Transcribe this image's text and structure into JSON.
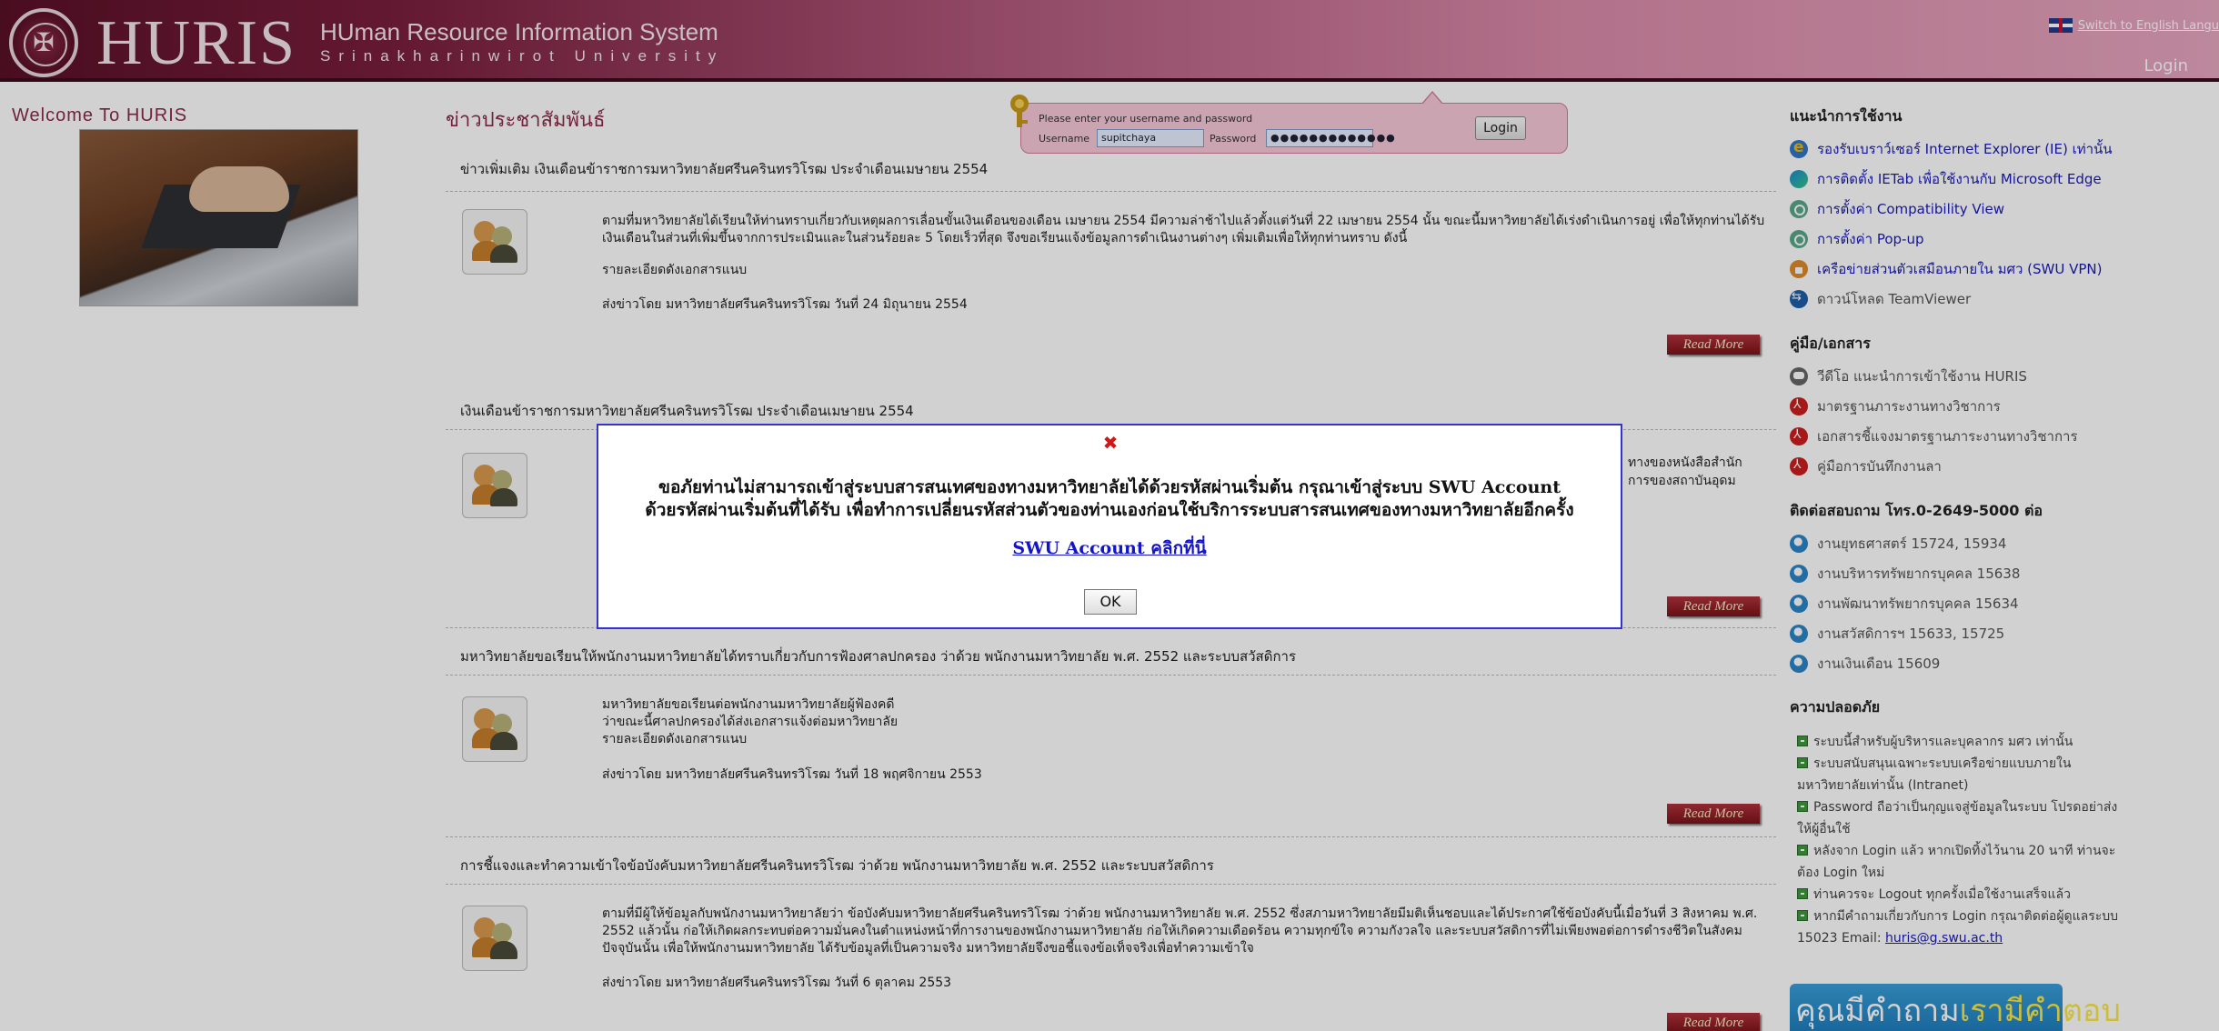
{
  "header": {
    "logo": "HURIS",
    "system_title": "HUman Resource Information System",
    "university": "Srinakharinwirot University",
    "lang_link": "Switch to English Langu",
    "login_link": "Login"
  },
  "left": {
    "welcome": "Welcome To HURIS"
  },
  "news": {
    "heading": "ข่าวประชาสัมพันธ์",
    "read_more": "Read More",
    "items": [
      {
        "title": "ข่าวเพิ่มเติม เงินเดือนข้าราชการมหาวิทยาลัยศรีนครินทรวิโรฒ ประจำเดือนเมษายน 2554",
        "body": [
          "ตามที่มหาวิทยาลัยได้เรียนให้ท่านทราบเกี่ยวกับเหตุผลการเลื่อนขั้นเงินเดือนของเดือน เมษายน 2554 มีความล่าช้าไปแล้วตั้งแต่วันที่ 22 เมษายน 2554 นั้น ขณะนี้มหาวิทยาลัยได้เร่งดำเนินการอยู่ เพื่อให้ทุกท่านได้รับเงินเดือนในส่วนที่เพิ่มขึ้นจากการประเมินและในส่วนร้อยละ 5 โดยเร็วที่สุด จึงขอเรียนแจ้งข้อมูลการดำเนินงานต่างๆ เพิ่มเติมเพื่อให้ทุกท่านทราบ ดังนี้",
          "รายละเอียดดังเอกสารแนบ",
          "ส่งข่าวโดย มหาวิทยาลัยศรีนครินทรวิโรฒ วันที่ 24 มิถุนายน 2554"
        ]
      },
      {
        "title": "เงินเดือนข้าราชการมหาวิทยาลัยศรีนครินทรวิโรฒ ประจำเดือนเมษายน 2554",
        "body_right": "ทางของหนังสือสำนัก",
        "body_right2": "การของสถาบันอุดม"
      },
      {
        "title": "มหาวิทยาลัยขอเรียนให้พนักงานมหาวิทยาลัยได้ทราบเกี่ยวกับการฟ้องศาลปกครอง ว่าด้วย พนักงานมหาวิทยาลัย พ.ศ. 2552 และระบบสวัสดิการ",
        "body": [
          "มหาวิทยาลัยขอเรียนต่อพนักงานมหาวิทยาลัยผู้ฟ้องคดี",
          "ว่าขณะนี้ศาลปกครองได้ส่งเอกสารแจ้งต่อมหาวิทยาลัย",
          "รายละเอียดดังเอกสารแนบ",
          "ส่งข่าวโดย มหาวิทยาลัยศรีนครินทรวิโรฒ วันที่ 18 พฤศจิกายน 2553"
        ]
      },
      {
        "title": "การชี้แจงและทำความเข้าใจข้อบังคับมหาวิทยาลัยศรีนครินทรวิโรฒ ว่าด้วย พนักงานมหาวิทยาลัย พ.ศ. 2552 และระบบสวัสดิการ",
        "body": [
          "ตามที่มีผู้ให้ข้อมูลกับพนักงานมหาวิทยาลัยว่า ข้อบังคับมหาวิทยาลัยศรีนครินทรวิโรฒ ว่าด้วย พนักงานมหาวิทยาลัย พ.ศ. 2552 ซึ่งสภามหาวิทยาลัยมีมติเห็นชอบและได้ประกาศใช้ข้อบังคับนี้เมื่อวันที่ 3 สิงหาคม พ.ศ. 2552 แล้วนั้น ก่อให้เกิดผลกระทบต่อความมั่นคงในตำแหน่งหน้าที่การงานของพนักงานมหาวิทยาลัย ก่อให้เกิดความเดือดร้อน ความทุกข์ใจ ความกังวลใจ และระบบสวัสดิการที่ไม่เพียงพอต่อการดำรงชีวิตในสังคมปัจจุบันนั้น เพื่อให้พนักงานมหาวิทยาลัย ได้รับข้อมูลที่เป็นความจริง มหาวิทยาลัยจึงขอชี้แจงข้อเท็จจริงเพื่อทำความเข้าใจ",
          "ส่งข่าวโดย มหาวิทยาลัยศรีนครินทรวิโรฒ วันที่ 6 ตุลาคม 2553"
        ]
      }
    ]
  },
  "login_box": {
    "message": "Please enter your username and password",
    "username_label": "Username",
    "username_value": "supitchaya",
    "password_label": "Password",
    "password_value": "●●●●●●●●●●●●●",
    "button": "Login"
  },
  "sidebar": {
    "recommend_heading": "แนะนำการใช้งาน",
    "recommend_items": [
      {
        "label": "รองรับเบราว์เซอร์ Internet Explorer (IE) เท่านั้น",
        "icon": "ie-icon"
      },
      {
        "label": "การติดตั้ง IETab เพื่อใช้งานกับ Microsoft Edge",
        "icon": "edge-icon"
      },
      {
        "label": "การตั้งค่า Compatibility View",
        "icon": "gear-icon"
      },
      {
        "label": "การตั้งค่า Pop-up",
        "icon": "gear-icon"
      },
      {
        "label": "เครือข่ายส่วนตัวเสมือนภายใน มศว (SWU VPN)",
        "icon": "lock-icon"
      },
      {
        "label": "ดาวน์โหลด TeamViewer",
        "icon": "teamviewer-icon"
      }
    ],
    "manual_heading": "คู่มือ/เอกสาร",
    "manual_items": [
      {
        "label": "วีดีโอ แนะนำการเข้าใช้งาน HURIS",
        "icon": "video-icon"
      },
      {
        "label": "มาตรฐานภาระงานทางวิชาการ",
        "icon": "pdf-icon"
      },
      {
        "label": "เอกสารชี้แจงมาตรฐานภาระงานทางวิชาการ",
        "icon": "pdf-icon"
      },
      {
        "label": "คู่มือการบันทึกงานลา",
        "icon": "pdf-icon"
      }
    ],
    "contact_heading": "ติดต่อสอบถาม โทร.0-2649-5000 ต่อ",
    "contact_items": [
      {
        "label": "งานยุทธศาสตร์ 15724, 15934",
        "icon": "person-icon"
      },
      {
        "label": "งานบริหารทรัพยากรบุคคล 15638",
        "icon": "person-icon"
      },
      {
        "label": "งานพัฒนาทรัพยากรบุคคล 15634",
        "icon": "person-icon"
      },
      {
        "label": "งานสวัสดิการฯ 15633, 15725",
        "icon": "person-icon"
      },
      {
        "label": "งานเงินเดือน 15609",
        "icon": "person-icon"
      }
    ],
    "security_heading": "ความปลอดภัย",
    "security_items": [
      "ระบบนี้สำหรับผู้บริหารและบุคลากร มศว เท่านั้น",
      "ระบบสนับสนุนเฉพาะระบบเครือข่ายแบบภายใน",
      "มหาวิทยาลัยเท่านั้น (Intranet)",
      "Password ถือว่าเป็นกุญแจสู่ข้อมูลในระบบ โปรดอย่าส่ง",
      "ให้ผู้อื่นใช้",
      "หลังจาก Login แล้ว หากเปิดทิ้งไว้นาน 20 นาที ท่านจะ",
      "ต้อง Login ใหม่",
      "ท่านควรจะ Logout ทุกครั้งเมื่อใช้งานเสร็จแล้ว",
      "หากมีคำถามเกี่ยวกับการ Login กรุณาติดต่อผู้ดูแลระบบ",
      "15023 Email: "
    ],
    "email": "huris@g.swu.ac.th",
    "banner_a": "คุณมีคำถาม",
    "banner_b": "เรามีคำตอบ"
  },
  "dialog": {
    "close_glyph": "✖",
    "message_line1": "ขอภัยท่านไม่สามารถเข้าสู่ระบบสารสนเทศของทางมหาวิทยาลัยได้ด้วยรหัสผ่านเริ่มต้น กรุณาเข้าสู่ระบบ SWU Account",
    "message_line2": "ด้วยรหัสผ่านเริ่มต้นที่ได้รับ เพื่อทำการเปลี่ยนรหัสส่วนตัวของท่านเองก่อนใช้บริการระบบสารสนเทศของทางมหาวิทยาลัยอีกครั้ง",
    "link": "SWU Account คลิกที่นี่",
    "ok": "OK"
  }
}
